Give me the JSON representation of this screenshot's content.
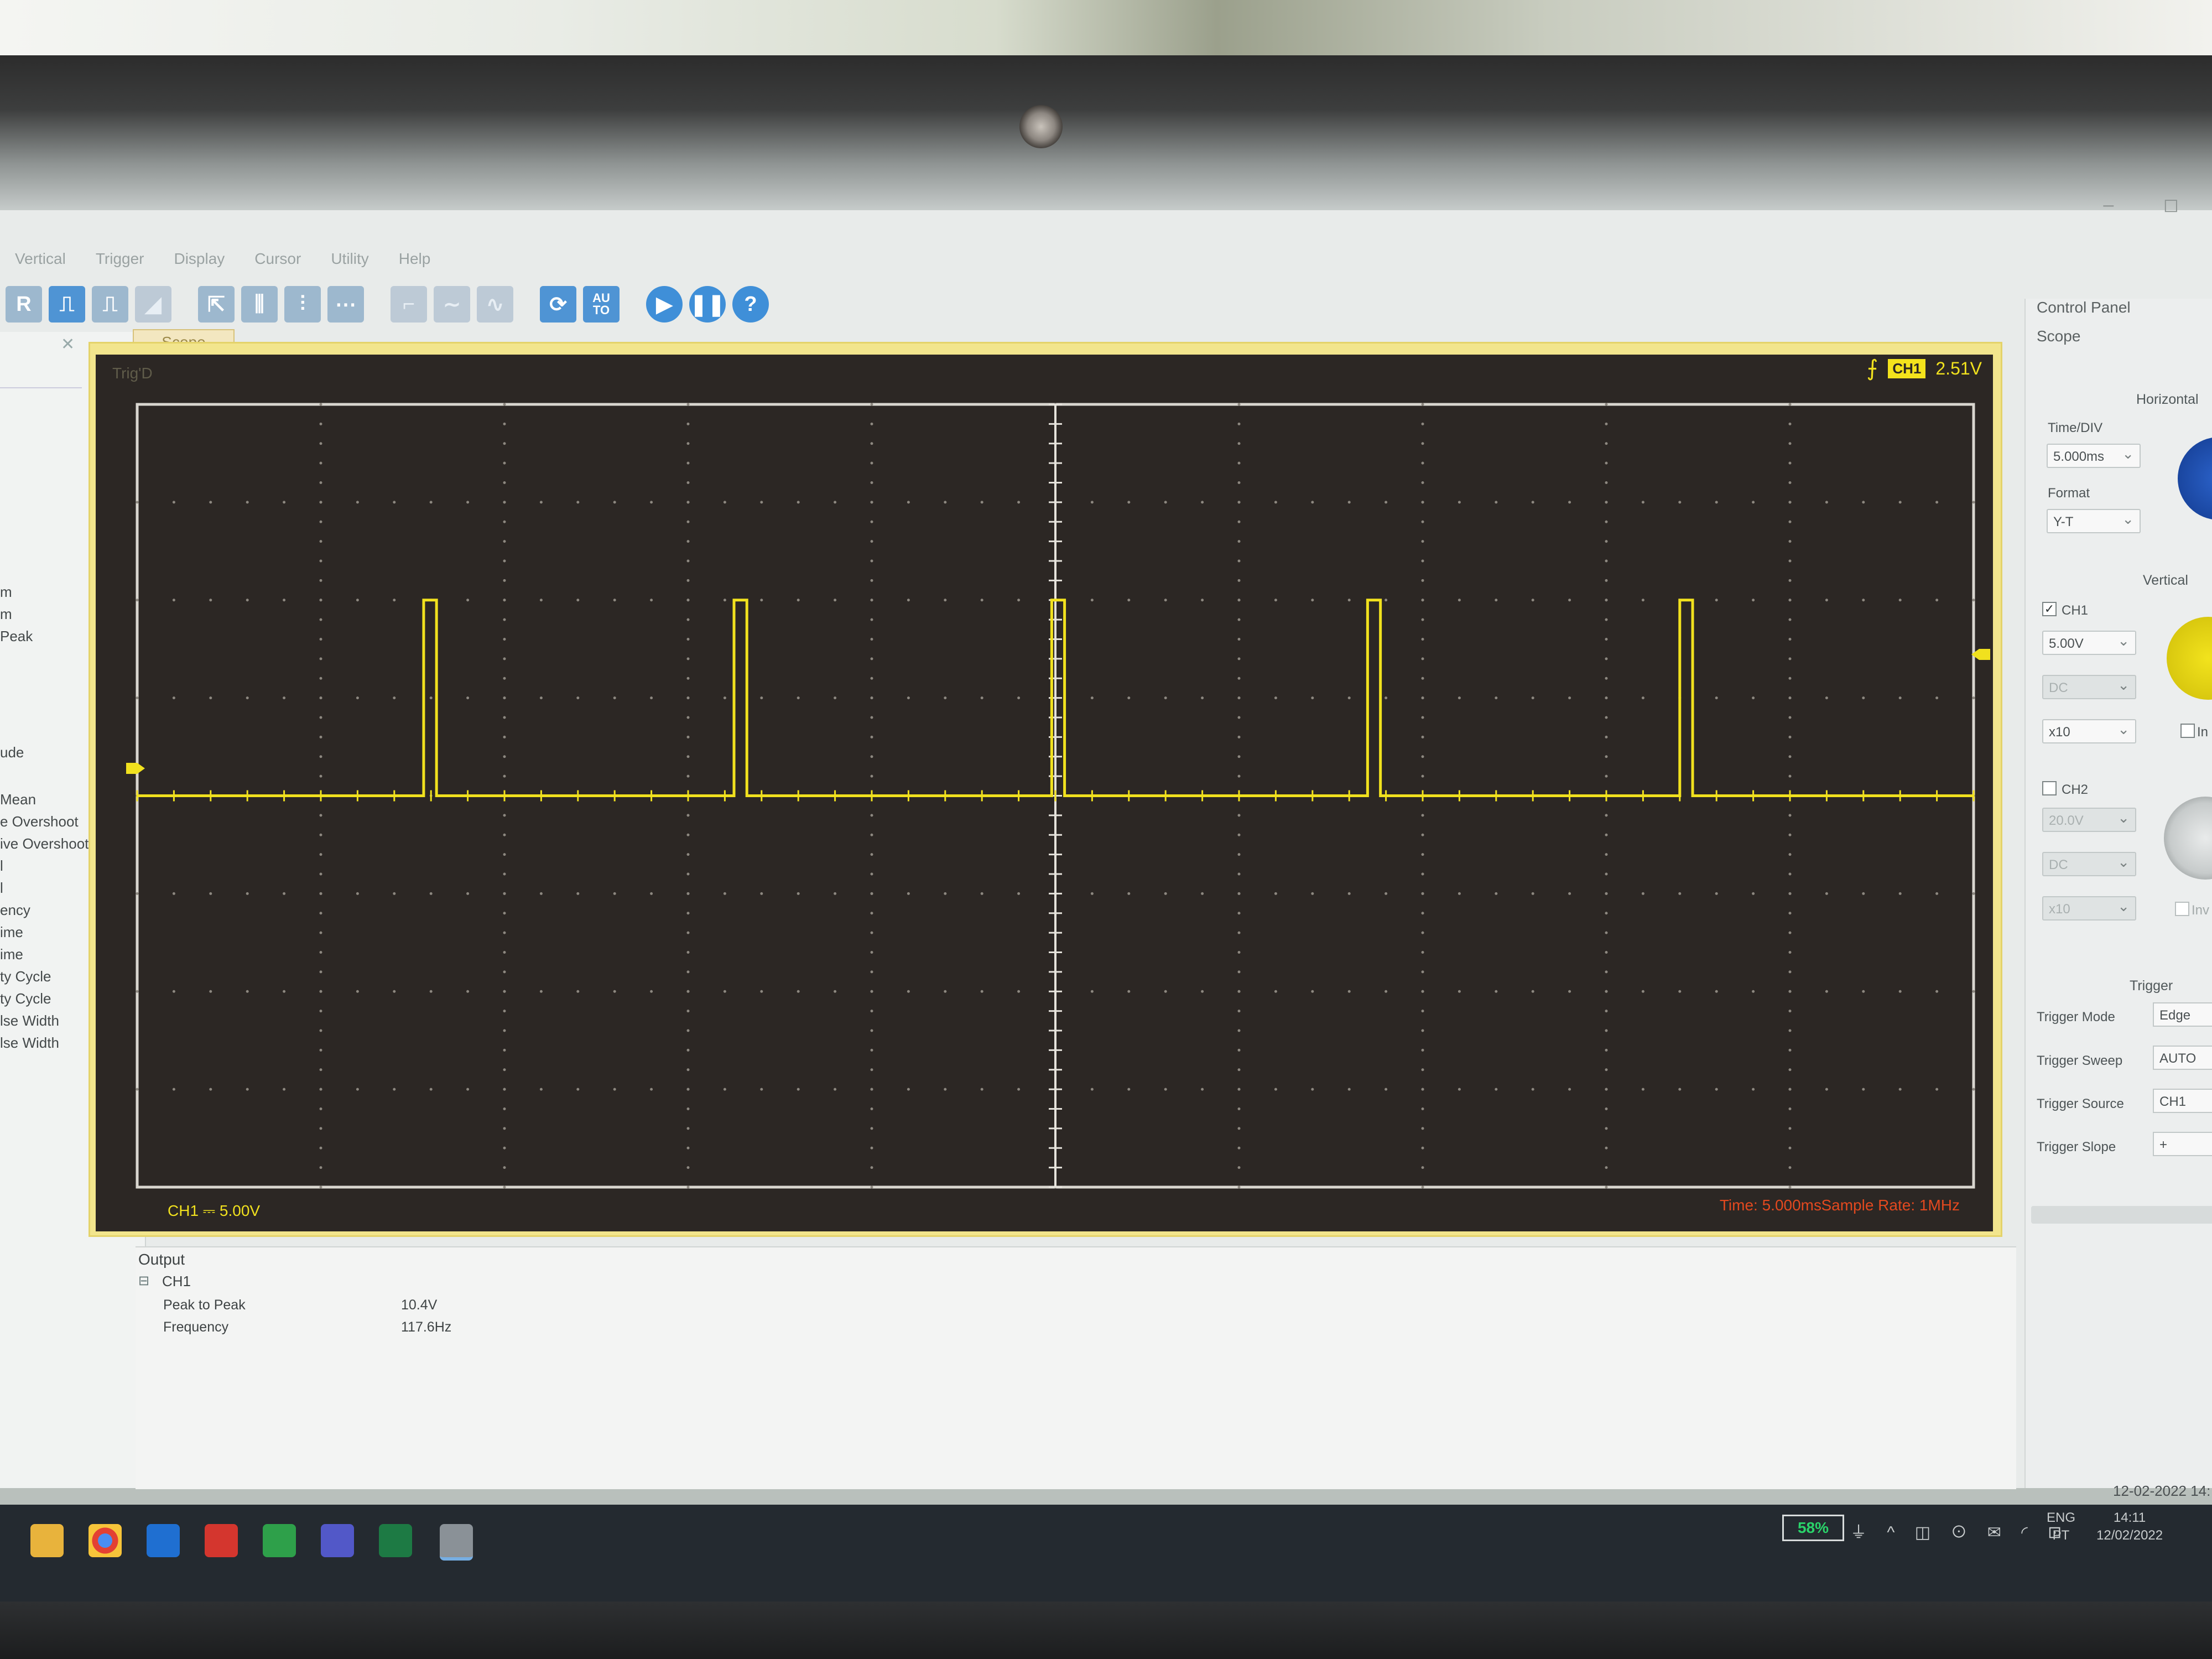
{
  "menu": [
    "Vertical",
    "Trigger",
    "Display",
    "Cursor",
    "Utility",
    "Help"
  ],
  "toolbar": {
    "first_label": "R",
    "auto_label": "AU\nTO",
    "help_label": "?"
  },
  "measurements": [
    "m",
    "m",
    "Peak",
    "ude",
    "Mean",
    "e Overshoot",
    "ive Overshoot",
    "l",
    "l",
    "ency",
    "ime",
    "ime",
    "ty Cycle",
    "ty Cycle",
    "lse Width",
    "lse Width"
  ],
  "tab": {
    "label": "Scope"
  },
  "scope": {
    "trig_status": "Trig'D",
    "trigger_channel": "CH1",
    "trigger_level": "2.51V",
    "channel_info": "CH1 ⎓ 5.00V",
    "time_info": "Time: 5.000ms",
    "sample_rate": "Sample Rate: 1MHz",
    "trace_color": "#f1e11e",
    "screen_color": "#2c2724"
  },
  "chart_data": {
    "type": "line",
    "time_per_div": "5.000ms",
    "volts_per_div": "5.00V",
    "divisions_x": 10,
    "divisions_y": 8,
    "series": [
      {
        "pulse_start_div": [
          1.56,
          3.25,
          4.98,
          6.7,
          8.4
        ],
        "pulse_width_div": 0.07,
        "low_level_div": 0,
        "high_level_div": 2.0
      }
    ]
  },
  "output": {
    "title": "Output",
    "channel": "CH1",
    "rows": [
      {
        "label": "Peak to Peak",
        "value": "10.4V"
      },
      {
        "label": "Frequency",
        "value": "117.6Hz"
      }
    ]
  },
  "control": {
    "title": "Control Panel",
    "subtitle": "Scope",
    "horizontal": "Horizontal",
    "time_div_label": "Time/DIV",
    "time_div": "5.000ms",
    "format_label": "Format",
    "format": "Y-T",
    "vertical": "Vertical",
    "ch1_label": "CH1",
    "ch1_volts": "5.00V",
    "ch1_coupling": "DC",
    "ch1_probe": "x10",
    "ch1_invert": "In",
    "ch2_label": "CH2",
    "ch2_volts": "20.0V",
    "ch2_coupling": "DC",
    "ch2_probe": "x10",
    "ch2_invert": "Inv",
    "trigger": "Trigger",
    "trigger_mode_label": "Trigger Mode",
    "trigger_mode": "Edge",
    "trigger_sweep_label": "Trigger Sweep",
    "trigger_sweep": "AUTO",
    "trigger_source_label": "Trigger Source",
    "trigger_source": "CH1",
    "trigger_slope_label": "Trigger Slope",
    "trigger_slope": "+"
  },
  "taskbar": {
    "battery": "58%",
    "lang_line1": "ENG",
    "lang_line2": "PT",
    "time": "14:11",
    "date": "12/02/2022",
    "status_date": "12-02-2022 14:"
  }
}
